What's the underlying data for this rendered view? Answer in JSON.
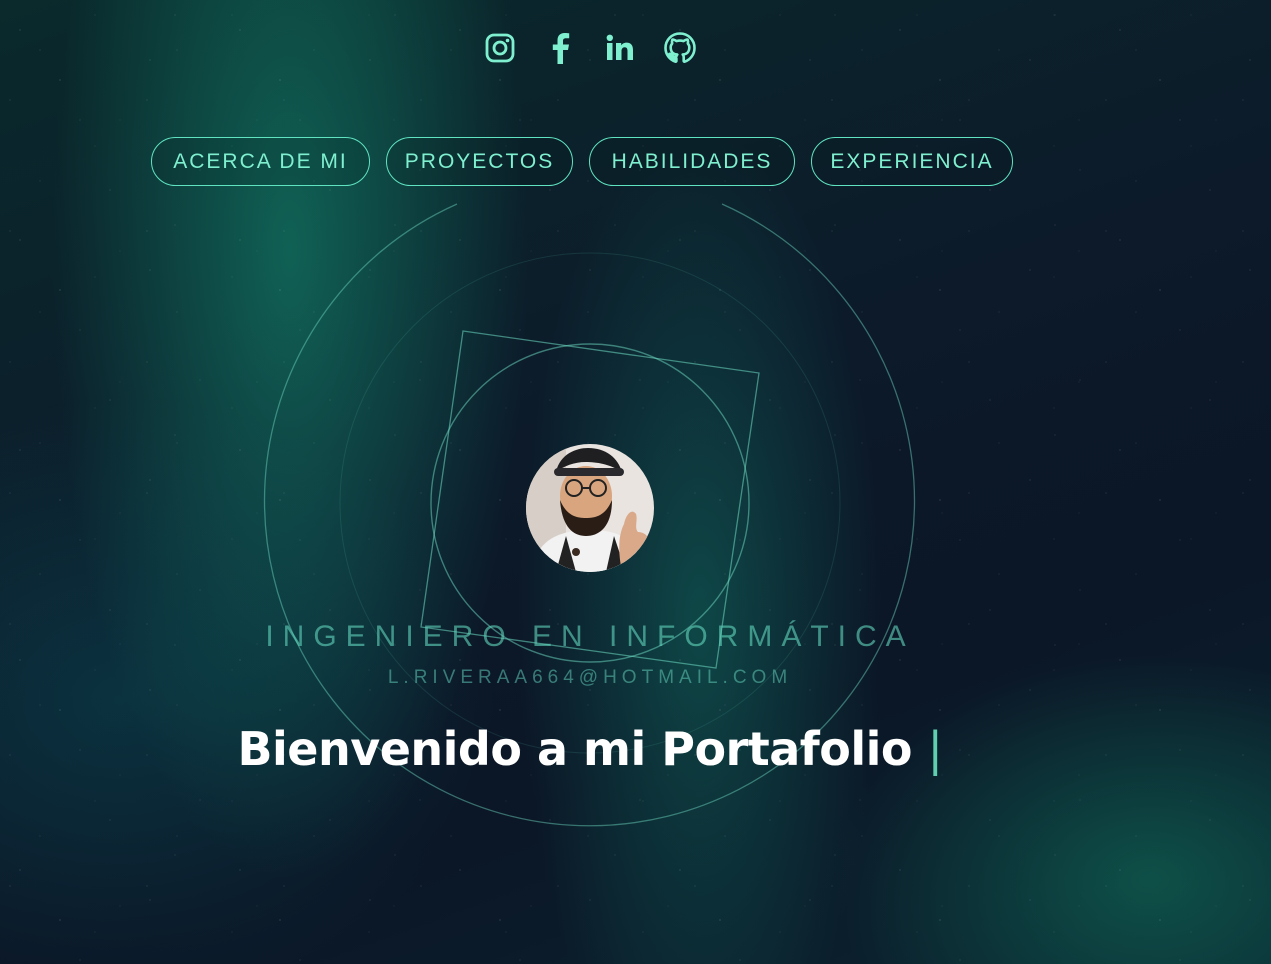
{
  "social": [
    {
      "name": "instagram-icon"
    },
    {
      "name": "facebook-icon"
    },
    {
      "name": "linkedin-icon"
    },
    {
      "name": "github-icon"
    }
  ],
  "nav": {
    "about": "ACERCA DE MI",
    "projects": "PROYECTOS",
    "skills": "HABILIDADES",
    "experience": "EXPERIENCIA"
  },
  "hero": {
    "role": "INGENIERO EN INFORMÁTICA",
    "email": "L.RIVERAA664@HOTMAIL.COM",
    "welcome": "Bienvenido a mi Portafolio",
    "cursor": "|"
  },
  "colors": {
    "accent": "#5fe3c0",
    "text": "#ffffff"
  }
}
